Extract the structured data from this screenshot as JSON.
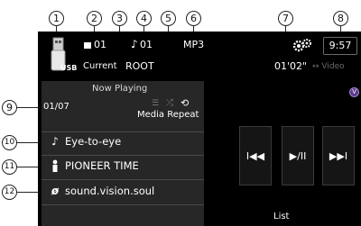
{
  "callouts": [
    "1",
    "2",
    "3",
    "4",
    "5",
    "6",
    "7",
    "8",
    "9",
    "10",
    "11",
    "12"
  ],
  "header": {
    "folder_number": "01",
    "track_number": "01",
    "format": "MP3",
    "source_label": "USB",
    "current_label": "Current",
    "folder_name": "ROOT",
    "clock": "9:57",
    "elapsed_time": "01'02\"",
    "video_label": "Video"
  },
  "now_playing": {
    "title": "Now Playing",
    "track_counter": "01/07",
    "media_repeat_label": "Media Repeat"
  },
  "tracks": {
    "song_title": "Eye-to-eye",
    "artist": "PIONEER TIME",
    "album": "sound.vision.soul"
  },
  "controls": {
    "prev_label": "I◀◀",
    "play_pause_label": "▶/II",
    "next_label": "▶▶I",
    "list_label": "List"
  },
  "icons": {
    "folder": "folder-icon",
    "note": "music-note-icon",
    "settings": "settings-gears-icon",
    "artist": "person-icon",
    "album": "disc-icon",
    "repeat": "repeat-icon",
    "shuffle": "shuffle-icon",
    "video_toggle": "double-arrow-icon"
  },
  "colors": {
    "screen_bg": "#000000",
    "panel_bg": "#272727",
    "text": "#ffffff",
    "accent_badge": "#5b3a8c"
  }
}
